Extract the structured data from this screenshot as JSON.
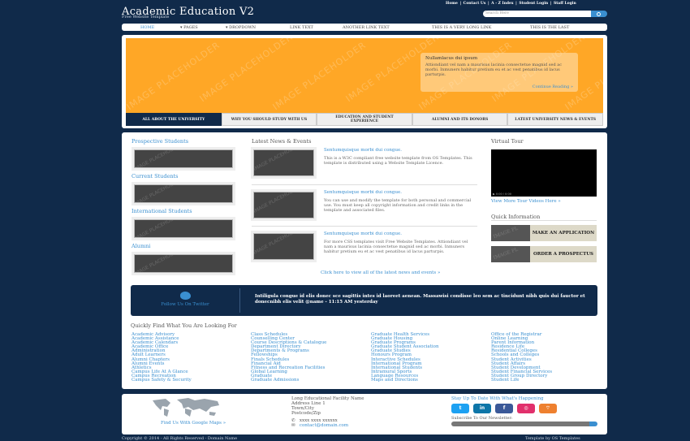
{
  "site": {
    "title": "Academic Education V2",
    "tagline": "Free Website Template"
  },
  "toplinks": [
    "Home",
    "Contact Us",
    "A - Z Index",
    "Student Login",
    "Staff Login"
  ],
  "search": {
    "placeholder": "Search Here"
  },
  "nav": [
    {
      "label": "Home",
      "active": true
    },
    {
      "label": "▾ Pages"
    },
    {
      "label": "▾ Dropdown"
    },
    {
      "label": "Link Text"
    },
    {
      "label": "Another Link Text"
    },
    {
      "label": "This Is A Very Long Link"
    },
    {
      "label": "This Is The Last"
    }
  ],
  "hero": {
    "caption_title": "Nullamlacus dui ipsum",
    "caption_body": "Attiondiant vel nam a maurisus lacinia consectetue magnid sed ac morbi. Inmuners habitur pretium eu et ac vest penatibus id lacus parturpis.",
    "caption_more": "Continue Reading »",
    "placeholder_text": "IMAGE PLACEHOLDER"
  },
  "hero_tabs": [
    {
      "label": "All About The University",
      "active": true
    },
    {
      "label": "Why You Should Study With Us"
    },
    {
      "label": "Education And Student Experience"
    },
    {
      "label": "Alumni And Its Donors"
    },
    {
      "label": "Latest University News & Events"
    }
  ],
  "left": {
    "sections": [
      "Prospective Students",
      "Current Students",
      "International Students",
      "Alumni"
    ]
  },
  "news": {
    "heading": "Latest News & Events",
    "items": [
      {
        "title": "Sentumquisque morbi dui congue.",
        "body": "This is a W3C compliant free website template from OS Templates. This template is distributed using a Website Template Licence."
      },
      {
        "title": "Sentumquisque morbi dui congue.",
        "body": "You can use and modify the template for both personal and commercial use. You must keep all copyright information and credit links in the template and associated files."
      },
      {
        "title": "Sentumquisque morbi dui congue.",
        "body": "For more CSS templates visit Free Website Templates. Attiondiant vel nam a maurisus lacinia consectetue magnid sed ac morbi. Inmuners habitur pretium eu et ac vest penatibus id lacus parturpis."
      }
    ],
    "more": "Click here to view all of the latest news and events »"
  },
  "right": {
    "tour_heading": "Virtual Tour",
    "tour_link": "View More Tour Videos Here »",
    "video_time": "0:00 / 0:00",
    "quick_heading": "Quick Information",
    "buttons": [
      "Make An Application",
      "Order A Prospectus"
    ]
  },
  "twitter": {
    "follow": "Follow Us On Twitter",
    "tweet": "Intiligula congue id elis donec sce sagittis intes id laoreet aenean. Massawisi condisse leo sem ac tincidunt nibh quis dui fauctor et donecnibh elis velit @name - 11:15 AM yesterday"
  },
  "quickfind": {
    "heading": "Quickly Find What You Are Looking For",
    "columns": [
      [
        "Academic Advisory",
        "Academic Assistance",
        "Academic Calendars",
        "Academic Office",
        "Administration",
        "Adult Learners",
        "Alumni Chapters",
        "Alumni Events",
        "Athletics",
        "Campus Life At A Glance",
        "Campus Recreation",
        "Campus Safety & Security"
      ],
      [
        "Class Schedules",
        "Counselling Center",
        "Course Descriptions & Catalogue",
        "Department Directory",
        "Departments & Programs",
        "Fellowships",
        "Finals Schedules",
        "Financial Aid",
        "Fitness and Recreation Facilities",
        "Global Learning",
        "Graduate",
        "Graduate Admissions"
      ],
      [
        "Graduate Health Services",
        "Graduate Housing",
        "Graduate Programs",
        "Graduate Student Association",
        "Graduate Studies",
        "Honours Program",
        "Interactive Schedules",
        "International Program",
        "International Students",
        "Intramural Sports",
        "Language Resources",
        "Maps and Directions"
      ],
      [
        "Office of the Registrar",
        "Online Learning",
        "Parent Information",
        "Residence Life",
        "Residential Colleges",
        "Schools and Colleges",
        "Student Activities",
        "Student Affairs",
        "Student Development",
        "Student Financial Services",
        "Student Group Directory",
        "Student Life"
      ]
    ]
  },
  "footer": {
    "map_link": "Find Us With Google Maps »",
    "address": [
      "Long Educational Facility Name",
      "Address Line 1",
      "Town/City",
      "Postcode/Zip"
    ],
    "phone": "xxxx xxxx xxxxxx",
    "email": "contact@domain.com",
    "stay": "Stay Up To Date With What's Happening",
    "subscribe": "Subscribe To Our Newsletter:",
    "copyright": "Copyright © 2014 - All Rights Reserved - Domain Name",
    "credit": "Template by OS Templates"
  },
  "colors": {
    "bg": "#102a4a",
    "accent": "#3a8fd0",
    "banner": "#ffa726",
    "twitter": "#1da1f2",
    "linkedin": "#0e76a8",
    "facebook": "#3b5998",
    "instagram": "#e1306c",
    "rss": "#ee802f"
  }
}
